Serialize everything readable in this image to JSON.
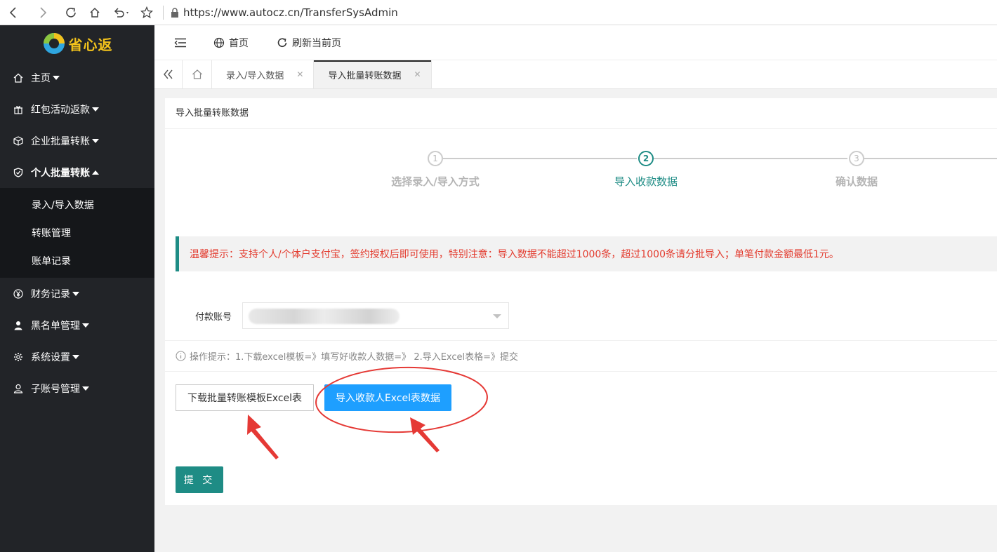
{
  "browser": {
    "url": "https://www.autocz.cn/TransferSysAdmin"
  },
  "sidebar": {
    "logo_text": "省心返",
    "items": [
      {
        "label": "主页",
        "icon": "home-icon"
      },
      {
        "label": "红包活动返款",
        "icon": "gift-icon"
      },
      {
        "label": "企业批量转账",
        "icon": "cube-icon"
      },
      {
        "label": "个人批量转账",
        "icon": "shield-icon"
      },
      {
        "label": "财务记录",
        "icon": "yen-icon"
      },
      {
        "label": "黑名单管理",
        "icon": "user-icon"
      },
      {
        "label": "系统设置",
        "icon": "gear-icon"
      },
      {
        "label": "子账号管理",
        "icon": "user-outline-icon"
      }
    ],
    "sub_items": [
      "录入/导入数据",
      "转账管理",
      "账单记录"
    ]
  },
  "header": {
    "home_label": "首页",
    "refresh_label": "刷新当前页"
  },
  "tabs": [
    {
      "label": "录入/导入数据"
    },
    {
      "label": "导入批量转账数据"
    }
  ],
  "card": {
    "title": "导入批量转账数据"
  },
  "steps": [
    {
      "num": "1",
      "label": "选择录入/导入方式"
    },
    {
      "num": "2",
      "label": "导入收款数据"
    },
    {
      "num": "3",
      "label": "确认数据"
    }
  ],
  "tip": "温馨提示：支持个人/个体户支付宝，签约授权后即可使用，特别注意：导入数据不能超过1000条，超过1000条请分批导入；单笔付款金额最低1元。",
  "form": {
    "account_label": "付款账号"
  },
  "hint": "操作提示：1.下载excel模板=》填写好收款人数据=》 2.导入Excel表格=》提交",
  "buttons": {
    "download": "下载批量转账模板Excel表",
    "import": "导入收款人Excel表数据",
    "submit": "提 交"
  },
  "colors": {
    "sidebar_bg": "#222428",
    "accent": "#1e8c85",
    "primary_blue": "#1e9fff",
    "tip_red": "#e33b2e",
    "annotation_red": "#e53935"
  }
}
